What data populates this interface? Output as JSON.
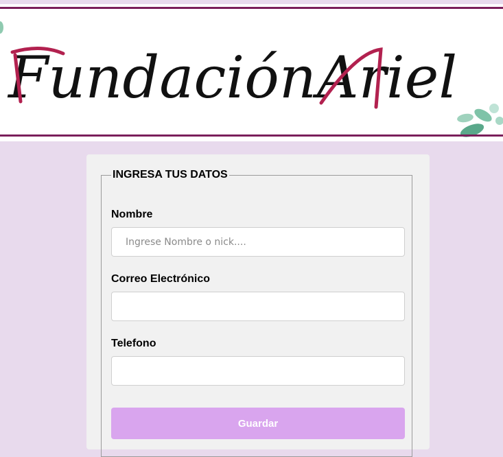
{
  "banner": {
    "logo_word1": "Fundación",
    "logo_word2": "Ariel",
    "colors": {
      "line": "#7a1e5a",
      "accent": "#b2214f",
      "ink": "#111111"
    }
  },
  "form": {
    "legend": "INGRESA TUS DATOS",
    "fields": [
      {
        "label": "Nombre",
        "placeholder": "Ingrese Nombre o nick....",
        "value": ""
      },
      {
        "label": "Correo Electrónico",
        "placeholder": "",
        "value": ""
      },
      {
        "label": "Telefono",
        "placeholder": "",
        "value": ""
      }
    ],
    "submit_label": "Guardar"
  },
  "colors": {
    "page_background": "#e8daed",
    "card_background": "#f1f1f1",
    "button_background": "#d9a5ee"
  }
}
